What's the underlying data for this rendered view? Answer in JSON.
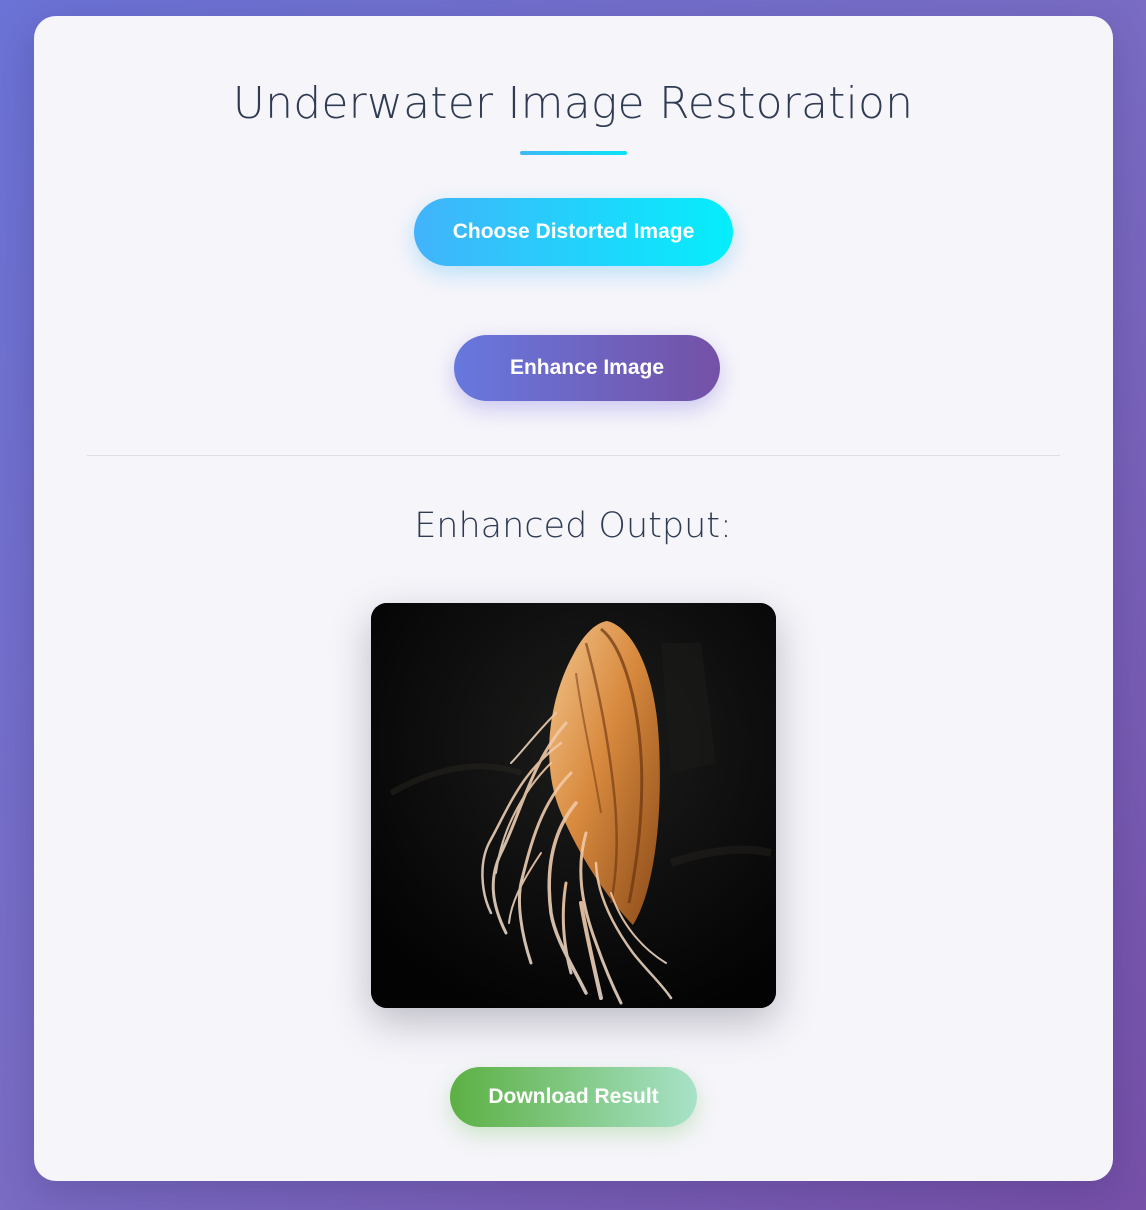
{
  "page": {
    "title": "Underwater Image Restoration",
    "accent_color": "#3fb8f5"
  },
  "actions": {
    "choose_label": "Choose Distorted Image",
    "enhance_label": "Enhance Image"
  },
  "output": {
    "heading": "Enhanced Output:",
    "image_subject": "jellyfish-photo",
    "download_label": "Download Result"
  },
  "colors": {
    "choose_button": [
      "#42b3fb",
      "#05eefc"
    ],
    "enhance_button": [
      "#6878de",
      "#7451a6"
    ],
    "download_button": [
      "#5cb043",
      "#a8e2c8"
    ],
    "background": [
      "#6b73d6",
      "#7750a8"
    ]
  }
}
